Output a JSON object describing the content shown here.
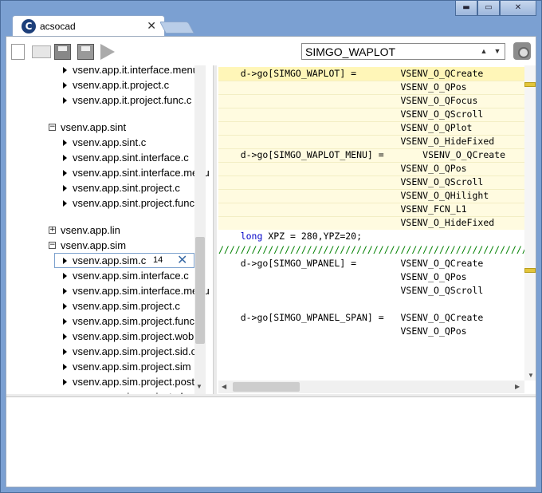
{
  "tab": {
    "logo": "C",
    "title": "acsocad",
    "close": "✕"
  },
  "window_buttons": {
    "minimize": "▬",
    "restore": "▭",
    "close": "✕"
  },
  "toolbar": {
    "icons": [
      "new-file-icon",
      "open-folder-icon",
      "save-icon",
      "save-all-icon",
      "run-icon"
    ],
    "search_value": "SIMGO_WAPLOT",
    "up": "▲",
    "down": "▼",
    "capture_icon": "camera-icon"
  },
  "tree": {
    "rows": [
      {
        "kind": "file",
        "label": "vsenv.app.it.interface.menu"
      },
      {
        "kind": "file",
        "label": "vsenv.app.it.project.c"
      },
      {
        "kind": "file",
        "label": "vsenv.app.it.project.func.c"
      },
      {
        "kind": "folder",
        "expanded": true,
        "toggle": "−",
        "label": "vsenv.app.sint"
      },
      {
        "kind": "file",
        "label": "vsenv.app.sint.c"
      },
      {
        "kind": "file",
        "label": "vsenv.app.sint.interface.c"
      },
      {
        "kind": "file",
        "label": "vsenv.app.sint.interface.menu"
      },
      {
        "kind": "file",
        "label": "vsenv.app.sint.project.c"
      },
      {
        "kind": "file",
        "label": "vsenv.app.sint.project.func"
      },
      {
        "kind": "folder",
        "expanded": false,
        "toggle": "+",
        "label": "vsenv.app.lin"
      },
      {
        "kind": "folder",
        "expanded": true,
        "toggle": "−",
        "label": "vsenv.app.sim"
      },
      {
        "kind": "file",
        "label": "vsenv.app.sim.c",
        "selected": true,
        "count": "14",
        "remove": "✕"
      },
      {
        "kind": "file",
        "label": "vsenv.app.sim.interface.c"
      },
      {
        "kind": "file",
        "label": "vsenv.app.sim.interface.menu"
      },
      {
        "kind": "file",
        "label": "vsenv.app.sim.project.c"
      },
      {
        "kind": "file",
        "label": "vsenv.app.sim.project.func"
      },
      {
        "kind": "file",
        "label": "vsenv.app.sim.project.wob"
      },
      {
        "kind": "file",
        "label": "vsenv.app.sim.project.sid.c"
      },
      {
        "kind": "file",
        "label": "vsenv.app.sim.project.sim"
      },
      {
        "kind": "file",
        "label": "vsenv.app.sim.project.post"
      },
      {
        "kind": "file",
        "label": "vsenv.app.sim.project.elec"
      }
    ]
  },
  "editor": {
    "lines": [
      {
        "text": "    d->go[SIMGO_WAPLOT] =        VSENV_O_QCreate",
        "highlight": "active"
      },
      {
        "text": "                                 VSENV_O_QPos",
        "highlight": "yes"
      },
      {
        "text": "                                 VSENV_O_QFocus",
        "highlight": "yes"
      },
      {
        "text": "                                 VSENV_O_QScroll",
        "highlight": "yes"
      },
      {
        "text": "                                 VSENV_O_QPlot",
        "highlight": "yes"
      },
      {
        "text": "                                 VSENV_O_HideFixed",
        "highlight": "yes"
      },
      {
        "text": "    d->go[SIMGO_WAPLOT_MENU] =       VSENV_O_QCreate",
        "highlight": "yes"
      },
      {
        "text": "                                 VSENV_O_QPos",
        "highlight": "yes"
      },
      {
        "text": "                                 VSENV_O_QScroll",
        "highlight": "yes"
      },
      {
        "text": "                                 VSENV_O_QHilight",
        "highlight": "yes"
      },
      {
        "text": "                                 VSENV_FCN_L1",
        "highlight": "yes"
      },
      {
        "text": "                                 VSENV_O_HideFixed",
        "highlight": "yes"
      },
      {
        "text": "long XPZ = 280,YPZ=20;",
        "highlight": "no",
        "kw": "long",
        "indent": "    "
      },
      {
        "text": "/////////////////////////////////////////////////////////////",
        "highlight": "no",
        "comment": true
      },
      {
        "text": "    d->go[SIMGO_WPANEL] =        VSENV_O_QCreate",
        "highlight": "no"
      },
      {
        "text": "                                 VSENV_O_QPos",
        "highlight": "no"
      },
      {
        "text": "                                 VSENV_O_QScroll",
        "highlight": "no"
      },
      {
        "text": "",
        "highlight": "no"
      },
      {
        "text": "    d->go[SIMGO_WPANEL_SPAN] =   VSENV_O_QCreate",
        "highlight": "no"
      },
      {
        "text": "                                 VSENV_O_QPos",
        "highlight": "no"
      }
    ]
  }
}
